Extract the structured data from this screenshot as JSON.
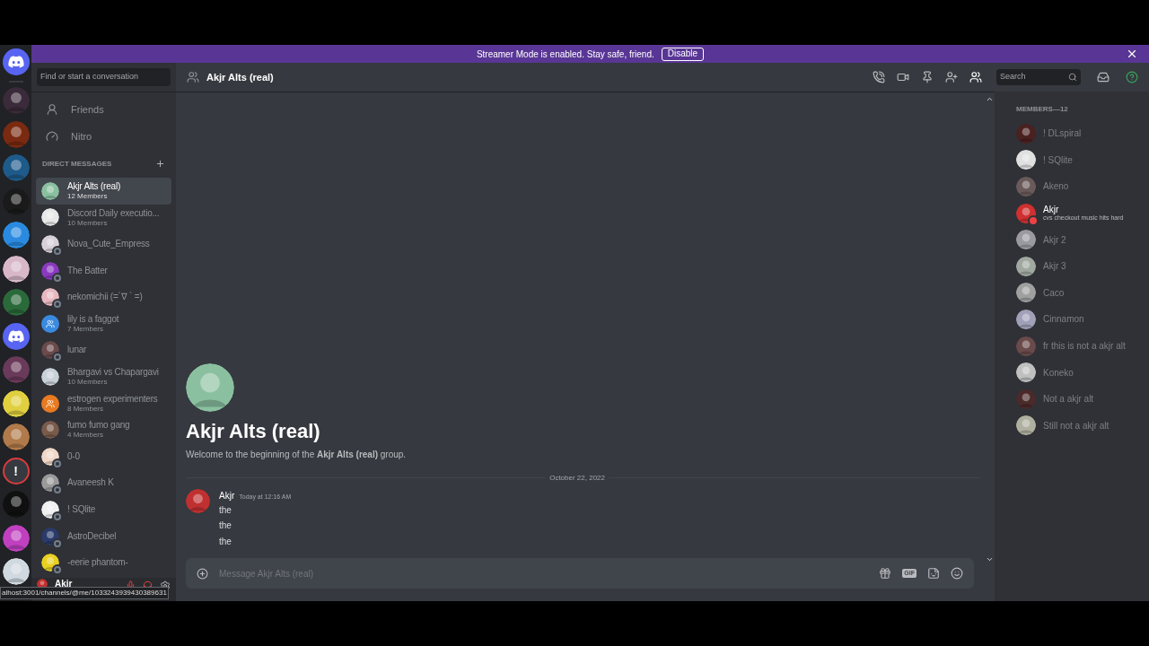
{
  "banner": {
    "text": "Streamer Mode is enabled. Stay safe, friend.",
    "button": "Disable"
  },
  "servers": [
    {
      "kind": "discord",
      "color": "#5865f2"
    },
    {
      "kind": "picture",
      "color": "#3a2a3a"
    },
    {
      "kind": "picture",
      "color": "#7a2a10"
    },
    {
      "kind": "picture",
      "color": "#1e5a8a"
    },
    {
      "kind": "picture",
      "color": "#1a1a1a"
    },
    {
      "kind": "picture",
      "color": "#2a8ae0"
    },
    {
      "kind": "picture",
      "color": "#d8b8c8"
    },
    {
      "kind": "picture",
      "color": "#2a6a3a"
    },
    {
      "kind": "discord",
      "color": "#5865f2"
    },
    {
      "kind": "picture",
      "color": "#6a3a5a"
    },
    {
      "kind": "picture",
      "color": "#e0d040"
    },
    {
      "kind": "picture",
      "color": "#b07a4a"
    },
    {
      "kind": "alert",
      "color": "#36393f",
      "label": "!"
    },
    {
      "kind": "picture",
      "color": "#101010"
    },
    {
      "kind": "picture",
      "color": "#c040c0"
    },
    {
      "kind": "picture",
      "color": "#d0d8e0"
    }
  ],
  "search": {
    "placeholder": "Find or start a conversation"
  },
  "nav": [
    {
      "kind": "friends",
      "label": "Friends"
    },
    {
      "kind": "nitro",
      "label": "Nitro"
    }
  ],
  "dm_header": "DIRECT MESSAGES",
  "dms": [
    {
      "kind": "group",
      "name": "Akjr Alts (real)",
      "members": "12 Members",
      "selected": true,
      "color": "#8ac0a0"
    },
    {
      "kind": "group",
      "name": "Discord Daily executio...",
      "members": "10 Members",
      "selected": false,
      "color": "#e8e8e8"
    },
    {
      "kind": "user",
      "name": "Nova_Cute_Empress",
      "selected": false,
      "color": "#d8d0d8"
    },
    {
      "kind": "user",
      "name": "The Batter",
      "selected": false,
      "color": "#8a3ac0"
    },
    {
      "kind": "user",
      "name": "nekomichii (=´∇ ` =)",
      "selected": false,
      "color": "#e8b8c0"
    },
    {
      "kind": "group",
      "name": "lily is a faggot",
      "members": "7 Members",
      "selected": false,
      "color": "#3a8ae0"
    },
    {
      "kind": "user",
      "name": "lunar",
      "selected": false,
      "color": "#6a4a4a"
    },
    {
      "kind": "group",
      "name": "Bhargavi vs Chapargavi",
      "members": "10 Members",
      "selected": false,
      "color": "#c8d0d8"
    },
    {
      "kind": "group",
      "name": "estrogen experimenters",
      "members": "8 Members",
      "selected": false,
      "color": "#e87a20"
    },
    {
      "kind": "group",
      "name": "fumo fumo gang",
      "members": "4 Members",
      "selected": false,
      "color": "#7a5a4a"
    },
    {
      "kind": "user",
      "name": "0-0",
      "selected": false,
      "color": "#f0d8c8"
    },
    {
      "kind": "user",
      "name": "Avaneesh K",
      "selected": false,
      "color": "#9a9a9a"
    },
    {
      "kind": "user",
      "name": "! SQlite",
      "selected": false,
      "color": "#f0f0f0"
    },
    {
      "kind": "user",
      "name": "AstroDecibel",
      "selected": false,
      "color": "#2a3a6a"
    },
    {
      "kind": "user",
      "name": "-eerie phantom-",
      "selected": false,
      "color": "#e8d020"
    }
  ],
  "user_panel": {
    "name": "Akjr",
    "mic_muted": true,
    "deafened": true
  },
  "url_tooltip": "alhost:3001/channels/@me/1033243939430389631",
  "channel": {
    "title": "Akjr Alts (real)",
    "search_placeholder": "Search"
  },
  "intro": {
    "title": "Akjr Alts (real)",
    "text": "Welcome to the beginning of the **Akjr Alts (real)** group."
  },
  "divider_date": "October 22, 2022",
  "messages": [
    {
      "author": "Akjr",
      "time": "Today at 12:16 AM",
      "lines": [
        "the",
        "the",
        "the"
      ]
    }
  ],
  "composer": {
    "placeholder": "Message Akjr Alts (real)",
    "gif_label": "GIF"
  },
  "members_header": "MEMBERS—12",
  "members": [
    {
      "name": "! DLspiral",
      "online": false,
      "color": "#4a2020"
    },
    {
      "name": "! SQlite",
      "online": false,
      "color": "#e0e0e0"
    },
    {
      "name": "Akeno",
      "online": false,
      "color": "#6a5a5a"
    },
    {
      "name": "Akjr",
      "online": true,
      "status": "cvs checkout music hits hard",
      "color": "#d03030"
    },
    {
      "name": "Akjr 2",
      "online": false,
      "color": "#9a9aa0"
    },
    {
      "name": "Akjr 3",
      "online": false,
      "color": "#a0a8a0"
    },
    {
      "name": "Caco",
      "online": false,
      "color": "#a0a0a0"
    },
    {
      "name": "Cinnamon",
      "online": false,
      "color": "#a0a0b8"
    },
    {
      "name": "fr this is not a akjr alt",
      "online": false,
      "color": "#6a4a4a"
    },
    {
      "name": "Koneko",
      "online": false,
      "color": "#c0c0c0"
    },
    {
      "name": "Not a akjr alt",
      "online": false,
      "color": "#4a2a2a"
    },
    {
      "name": "Still not a akjr alt",
      "online": false,
      "color": "#b0b0a0"
    }
  ]
}
